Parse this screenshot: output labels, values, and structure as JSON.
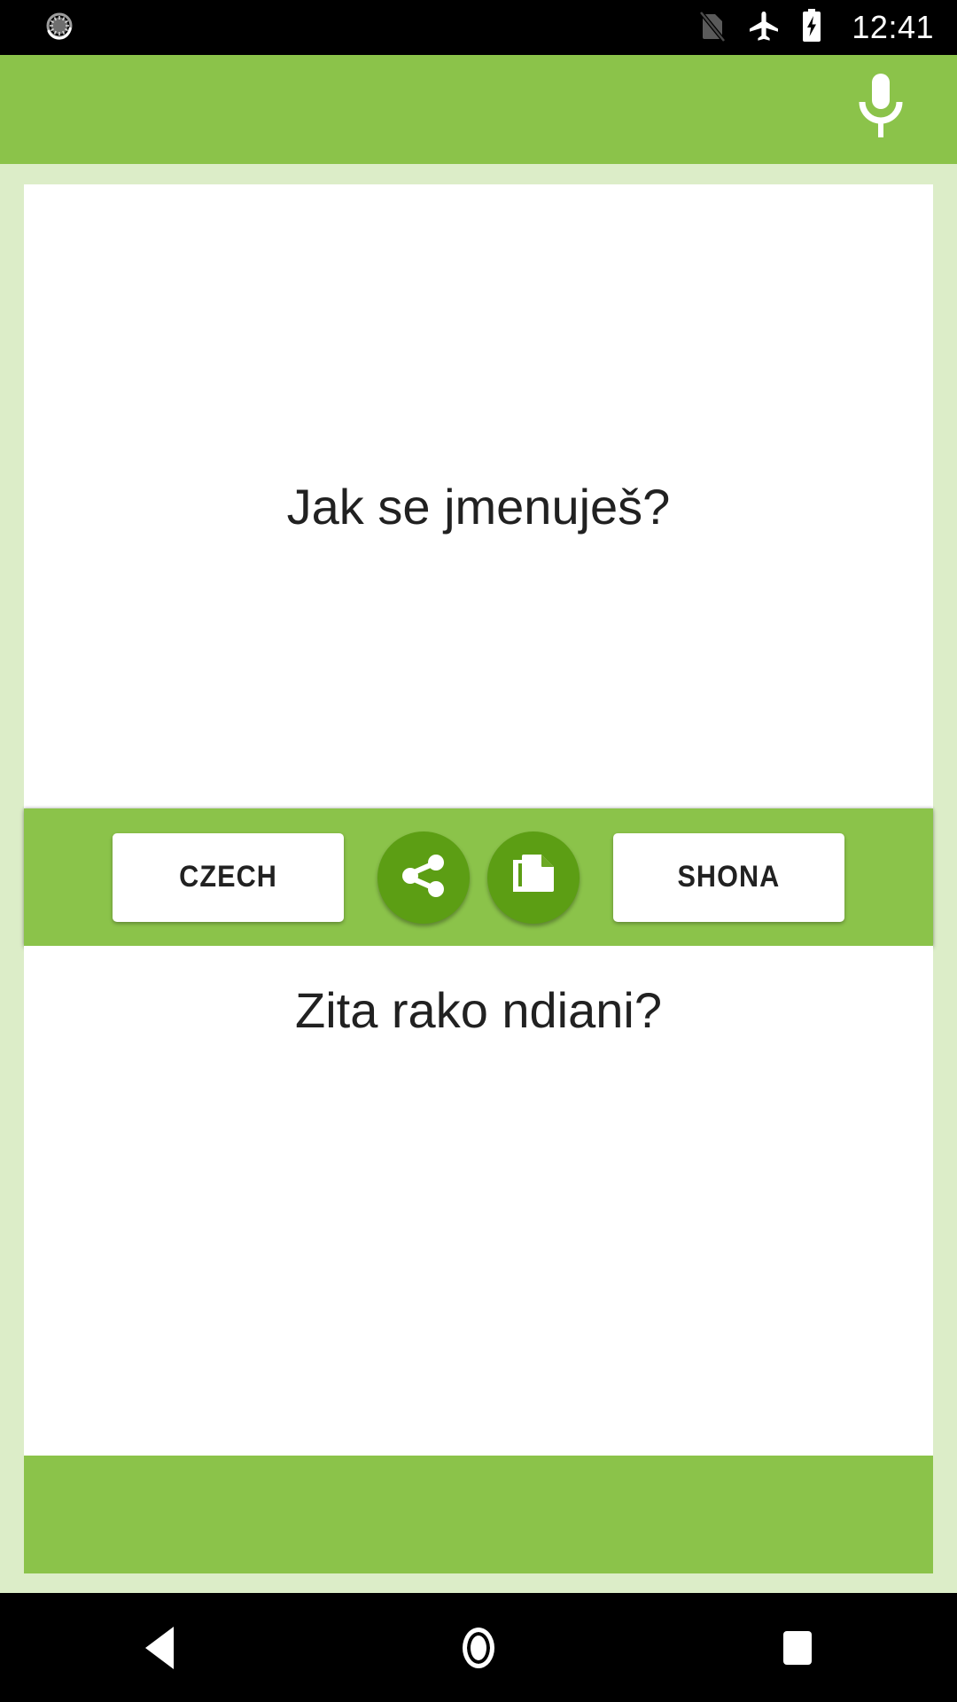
{
  "status_bar": {
    "notification_icon": "sync-circle-icon",
    "icons": [
      "no-sim-icon",
      "airplane-mode-icon",
      "battery-charging-icon"
    ],
    "clock": "12:41"
  },
  "app_bar": {
    "mic_icon": "microphone-icon",
    "mic_label": ""
  },
  "translation": {
    "source_text": "Jak se jmenuješ?",
    "target_text": "Zita rako ndiani?",
    "source_language": "CZECH",
    "target_language": "SHONA"
  },
  "actions": {
    "share_icon": "share-icon",
    "copy_icon": "copy-icon"
  },
  "nav_bar": {
    "back": "back-icon",
    "home": "home-icon",
    "recents": "recents-icon"
  },
  "colors": {
    "primary_green": "#8BC34A",
    "dark_green": "#5C9E14",
    "background_green": "#DCEDC8",
    "card_white": "#FFFFFF",
    "text_dark": "#212121",
    "status_black": "#000000"
  }
}
